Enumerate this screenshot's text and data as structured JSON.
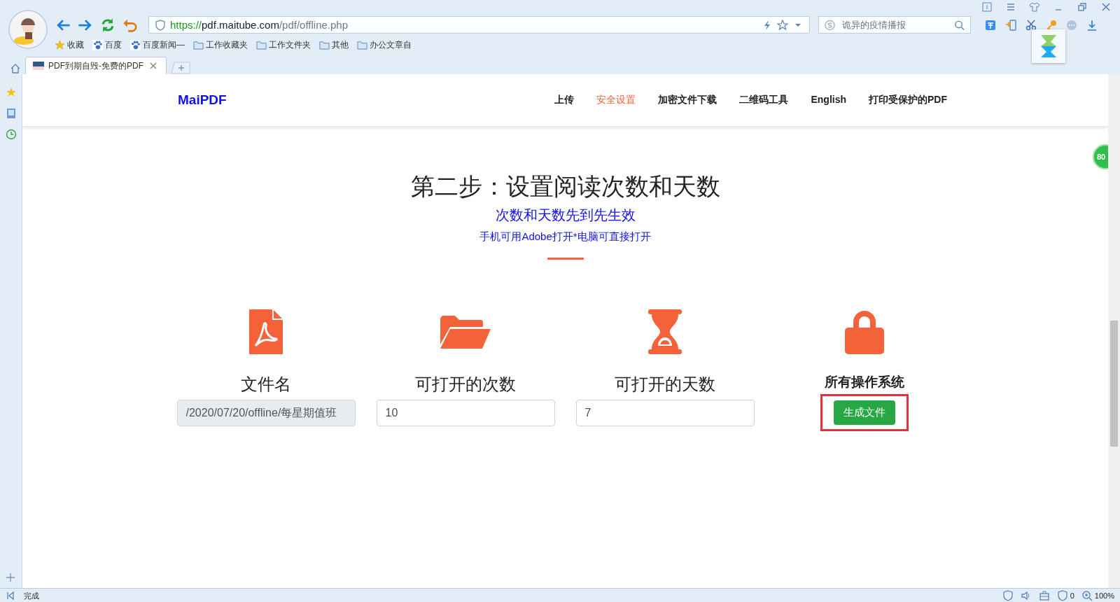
{
  "browser": {
    "address": {
      "scheme": "https://",
      "host": "pdf.maitube.com",
      "path": "/pdf/offline.php"
    },
    "search": {
      "placeholder": "诡异的疫情播报"
    },
    "bookmarks": [
      {
        "label": "收藏",
        "kind": "star"
      },
      {
        "label": "百度",
        "kind": "paw"
      },
      {
        "label": "百度新闻—",
        "kind": "paw"
      },
      {
        "label": "工作收藏夹",
        "kind": "folder"
      },
      {
        "label": "工作文件夹",
        "kind": "folder"
      },
      {
        "label": "其他",
        "kind": "folder"
      },
      {
        "label": "办公文章自",
        "kind": "folder"
      }
    ],
    "tabs": [
      {
        "title": "PDF到期自毁-免费的PDF",
        "selected": true
      }
    ],
    "side_badge": "80",
    "status_bar": {
      "text": "完成",
      "blocked": "0",
      "zoom": "100%"
    }
  },
  "site": {
    "logo": "MaiPDF",
    "nav": [
      {
        "label": "上传",
        "selected": false
      },
      {
        "label": "安全设置",
        "selected": true
      },
      {
        "label": "加密文件下载",
        "selected": false
      },
      {
        "label": "二维码工具",
        "selected": false
      },
      {
        "label": "English",
        "selected": false
      },
      {
        "label": "打印受保护的PDF",
        "selected": false
      }
    ],
    "title": "第二步：设置阅读次数和天数",
    "subtitle": "次数和天数先到先生效",
    "note": "手机可用Adobe打开*电脑可直接打开",
    "columns": [
      {
        "kind": "pdf",
        "label": "文件名",
        "value": "/2020/07/20/offline/每星期值班",
        "disabled": true
      },
      {
        "kind": "folder",
        "label": "可打开的次数",
        "value": "10",
        "disabled": false
      },
      {
        "kind": "hourglass",
        "label": "可打开的天数",
        "value": "7",
        "disabled": false
      },
      {
        "kind": "lock",
        "label": "所有操作系统",
        "button": "生成文件",
        "highlighted": true
      }
    ]
  }
}
